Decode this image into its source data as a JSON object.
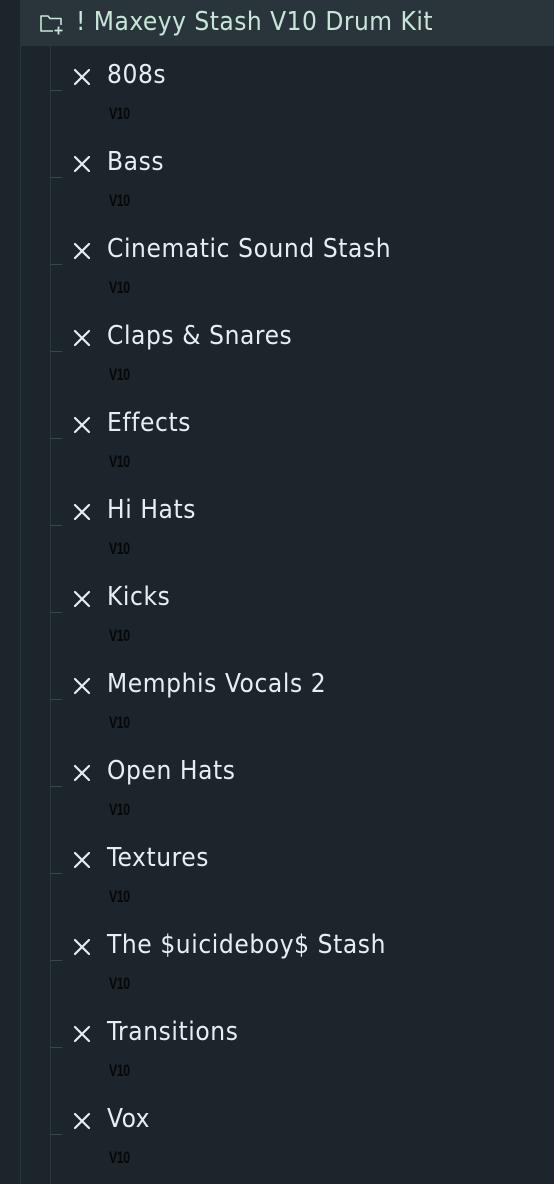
{
  "browser": {
    "folder": {
      "label": "! Maxeyy Stash V10 Drum Kit",
      "icon": "folder-add-icon"
    },
    "items": [
      {
        "label": "808s",
        "tag": "V10",
        "icon": "x-icon"
      },
      {
        "label": "Bass",
        "tag": "V10",
        "icon": "x-icon"
      },
      {
        "label": "Cinematic Sound Stash",
        "tag": "V10",
        "icon": "x-icon"
      },
      {
        "label": "Claps & Snares",
        "tag": "V10",
        "icon": "x-icon"
      },
      {
        "label": "Effects",
        "tag": "V10",
        "icon": "x-icon"
      },
      {
        "label": "Hi Hats",
        "tag": "V10",
        "icon": "x-icon"
      },
      {
        "label": "Kicks",
        "tag": "V10",
        "icon": "x-icon"
      },
      {
        "label": "Memphis Vocals 2",
        "tag": "V10",
        "icon": "x-icon"
      },
      {
        "label": "Open Hats",
        "tag": "V10",
        "icon": "x-icon"
      },
      {
        "label": "Textures",
        "tag": "V10",
        "icon": "x-icon"
      },
      {
        "label": "The $uicideboy$ Stash",
        "tag": "V10",
        "icon": "x-icon"
      },
      {
        "label": "Transitions",
        "tag": "V10",
        "icon": "x-icon"
      },
      {
        "label": "Vox",
        "tag": "V10",
        "icon": "x-icon"
      }
    ]
  },
  "colors": {
    "background": "#1c252b",
    "header_background": "#2a343b",
    "folder_text": "#c8e6d8",
    "item_text": "#e6eef2",
    "tag_text": "#050708"
  }
}
